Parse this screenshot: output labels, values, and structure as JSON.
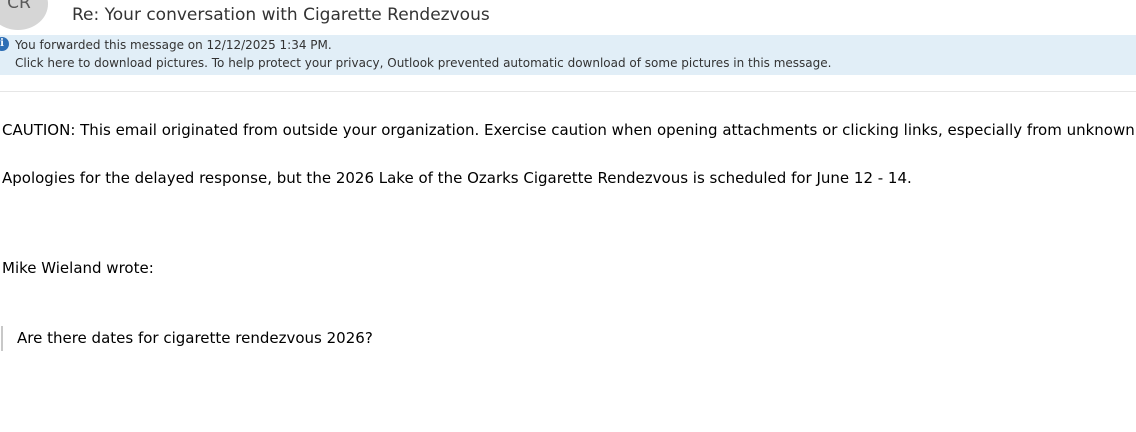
{
  "email": {
    "avatar_initials": "CR",
    "subject": "Re: Your conversation with Cigarette Rendezvous"
  },
  "infobar": {
    "icon": "info-icon",
    "forwarded_text": "You forwarded this message on 12/12/2025 1:34 PM.",
    "download_text": "Click here to download pictures. To help protect your privacy, Outlook prevented automatic download of some pictures in this message."
  },
  "body": {
    "caution": "CAUTION: This email originated from outside your organization. Exercise caution when opening attachments or clicking links, especially from unknown se",
    "apology": "Apologies for the delayed response, but the 2026 Lake of the Ozarks Cigarette Rendezvous is scheduled for June 12 - 14.",
    "wrote_line": "Mike Wieland wrote:",
    "quoted_text": "Are there dates for cigarette rendezvous 2026?"
  }
}
